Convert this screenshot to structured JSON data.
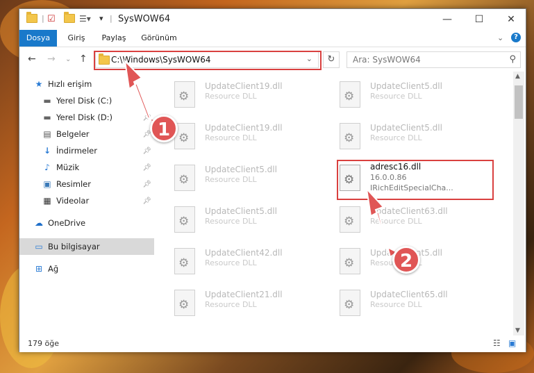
{
  "window": {
    "title": "SysWOW64"
  },
  "ribbon": {
    "tabs": [
      "Dosya",
      "Giriş",
      "Paylaş",
      "Görünüm"
    ]
  },
  "address": {
    "path": "C:\\Windows\\SysWOW64"
  },
  "search": {
    "placeholder": "Ara: SysWOW64"
  },
  "nav": {
    "items": [
      {
        "label": "Hızlı erişim",
        "icon": "star-icon"
      },
      {
        "label": "Yerel Disk (C:)",
        "icon": "drive-icon"
      },
      {
        "label": "Yerel Disk (D:)",
        "icon": "drive-icon"
      },
      {
        "label": "Belgeler",
        "icon": "documents-icon"
      },
      {
        "label": "İndirmeler",
        "icon": "download-icon"
      },
      {
        "label": "Müzik",
        "icon": "music-icon"
      },
      {
        "label": "Resimler",
        "icon": "pictures-icon"
      },
      {
        "label": "Videolar",
        "icon": "video-icon"
      },
      {
        "label": "OneDrive",
        "icon": "cloud-icon"
      },
      {
        "label": "Bu bilgisayar",
        "icon": "computer-icon"
      },
      {
        "label": "Ağ",
        "icon": "network-icon"
      }
    ]
  },
  "files": [
    {
      "name": "UpdateClient19.dll",
      "desc": "Resource DLL"
    },
    {
      "name": "UpdateClient5.dll",
      "desc": "Resource DLL"
    },
    {
      "name": "UpdateClient19.dll",
      "desc": "Resource DLL"
    },
    {
      "name": "UpdateClient5.dll",
      "desc": "Resource DLL"
    },
    {
      "name": "UpdateClient5.dll",
      "desc": "Resource DLL"
    },
    {
      "name": "adresc16.dll",
      "desc": "16.0.0.86",
      "desc2": "IRichEditSpecialCha..."
    },
    {
      "name": "UpdateClient5.dll",
      "desc": "Resource DLL"
    },
    {
      "name": "UpdateClient63.dll",
      "desc": "Resource DLL"
    },
    {
      "name": "UpdateClient42.dll",
      "desc": "Resource DLL"
    },
    {
      "name": "UpdateClient5.dll",
      "desc": "Resource DLL"
    },
    {
      "name": "UpdateClient21.dll",
      "desc": "Resource DLL"
    },
    {
      "name": "UpdateClient65.dll",
      "desc": "Resource DLL"
    }
  ],
  "status": {
    "count": "179 öğe"
  },
  "callouts": {
    "one": "1",
    "two": "2"
  },
  "colors": {
    "accent": "#1979ca",
    "highlight": "#d9403f",
    "callout": "#e05656"
  }
}
